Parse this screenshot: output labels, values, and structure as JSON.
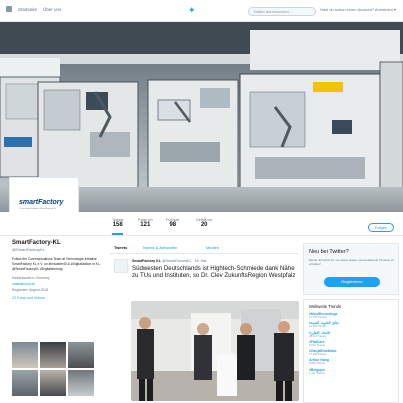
{
  "nav": {
    "home_label": "Startseite",
    "about_label": "Über uns",
    "search_placeholder": "Twitter durchsuchen",
    "login_text": "Hast du schon einen Account? Anmelden ▾"
  },
  "profile": {
    "avatar_logo": "smartFactory",
    "avatar_subtitle": "Technologie-Initiative SmartFactory KL",
    "name": "SmartFactory-KL",
    "handle": "@SmartFactoryKL",
    "bio": "Follow the Communications Team at Technologie-Initiative SmartFactory KL e.V. on #Industrie40 & #Digitalization in KL, @SmartFactoryKL #Digitalisierung",
    "location": "Kaiserslautern, Germany",
    "website": "smartfactory.de",
    "joined": "Registriert: August 2016",
    "photos_link": "23 Fotos und Videos"
  },
  "stats": {
    "tweets_label": "Tweets",
    "tweets_value": "158",
    "following_label": "Folge ich",
    "following_value": "121",
    "followers_label": "Follower",
    "followers_value": "98",
    "likes_label": "Gefällt mir",
    "likes_value": "20",
    "follow_button": "Folgen"
  },
  "tabs": {
    "tweets": "Tweets",
    "replies": "Tweets & Antworten",
    "media": "Medien"
  },
  "tweet": {
    "author": "SmartFactory KL",
    "meta": "@SmartFactoryKL · 16. Mai",
    "text": "Südwesten Deutschlands ist Hightech-Schmiede dank Nähe zu TUs und Instituten, so Dr. Clev ZukunftsRegion Westpfalz"
  },
  "signup": {
    "title": "Neu bei Twitter?",
    "text": "Melde dich jetzt an, um deine eigene personalisierte Timeline zu erhalten!",
    "button": "Registrieren"
  },
  "trends": {
    "title": "Weltweite Trends",
    "items": [
      {
        "name": "#MindRecordings",
        "count": "21.700 Tweets"
      },
      {
        "name": "#نتائج_الثانوية_العامة",
        "count": "12.800 Tweets"
      },
      {
        "name": "#الاتحاد_الاهلي",
        "count": "38.100 Tweets"
      },
      {
        "name": "#FlatCare",
        "count": "9.541 Tweets"
      },
      {
        "name": "#GanjaBlueMobs",
        "count": "17.300 Tweets"
      },
      {
        "name": "Arthur Hang",
        "count": "5.862 Tweets"
      },
      {
        "name": "#Belgique",
        "count": "4.411 Tweets"
      }
    ]
  },
  "colors": {
    "accent": "#1da1f2",
    "text": "#14171a",
    "muted": "#657786",
    "border": "#e1e8ed"
  }
}
